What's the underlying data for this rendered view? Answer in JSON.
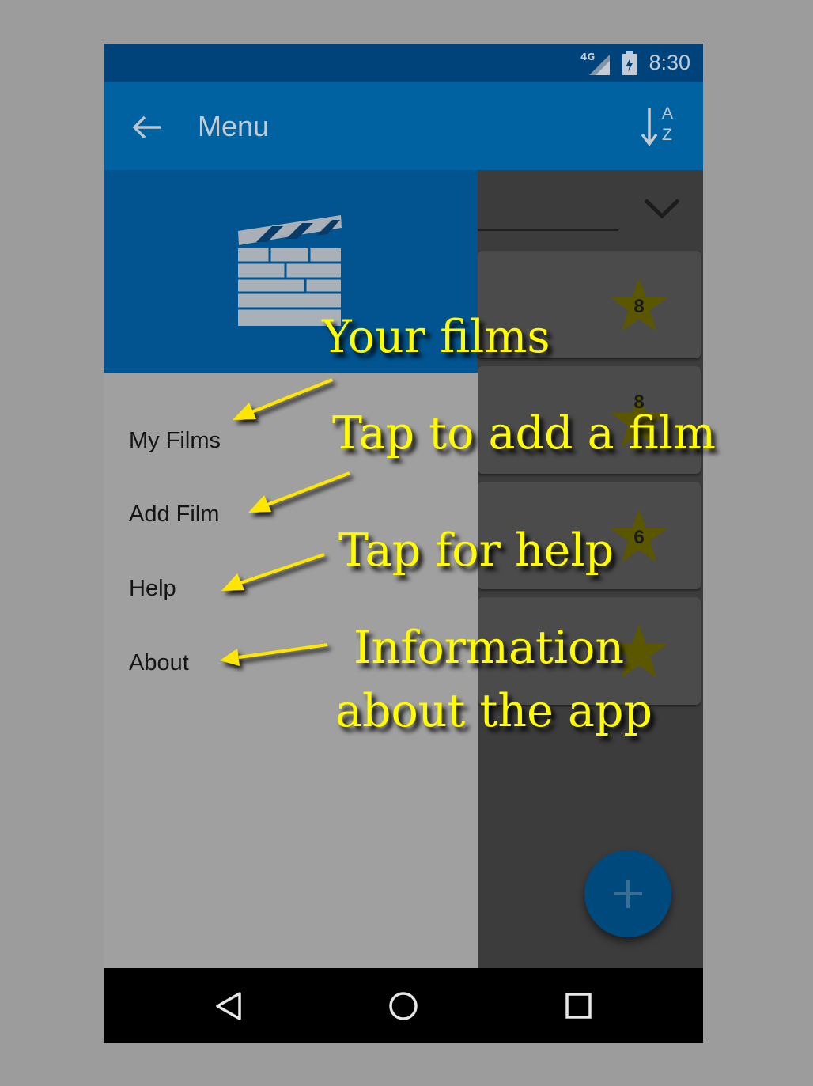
{
  "status_bar": {
    "network": "4G",
    "time": "8:30"
  },
  "toolbar": {
    "title": "Menu",
    "back_icon": "arrow-left-icon",
    "sort_icon": "sort-az-icon",
    "sort_letters": [
      "A",
      "Z"
    ]
  },
  "drawer": {
    "header_icon": "clapperboard-icon",
    "items": [
      {
        "label": "My Films"
      },
      {
        "label": "Add Film"
      },
      {
        "label": "Help"
      },
      {
        "label": "About"
      }
    ]
  },
  "background_list": {
    "ratings": [
      "8",
      "8",
      "6",
      ""
    ]
  },
  "fab": {
    "icon": "plus-icon"
  },
  "callouts": {
    "your_films": "Your films",
    "add_film": "Tap to add a film",
    "help": "Tap for help",
    "about_line1": "Information",
    "about_line2": "about the app"
  },
  "nav_bar": {
    "back_icon": "triangle-back-icon",
    "home_icon": "circle-home-icon",
    "recents_icon": "square-recents-icon"
  },
  "colors": {
    "status_bar": "#00427a",
    "toolbar": "#0062a1",
    "drawer_header": "#01548f",
    "drawer_bg": "#a0a0a0",
    "callout_text": "#fffb00"
  }
}
